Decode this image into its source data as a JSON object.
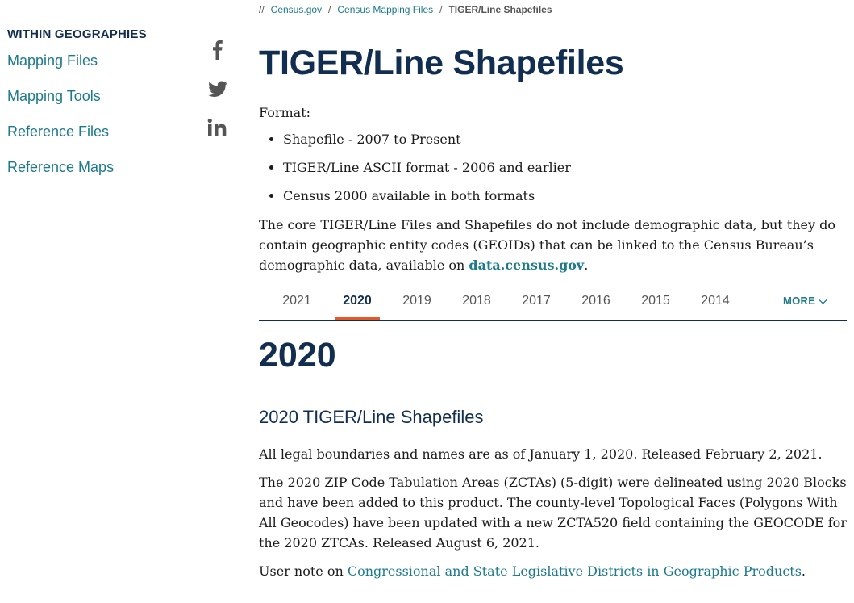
{
  "sidebar": {
    "heading": "WITHIN GEOGRAPHIES",
    "items": [
      {
        "label": "Mapping Files"
      },
      {
        "label": "Mapping Tools"
      },
      {
        "label": "Reference Files"
      },
      {
        "label": "Reference Maps"
      }
    ]
  },
  "social": {
    "icons": [
      "facebook-icon",
      "twitter-icon",
      "linkedin-icon"
    ]
  },
  "breadcrumb": {
    "lead": "//",
    "items": [
      "Census.gov",
      "Census Mapping Files"
    ],
    "separator": "/",
    "current": "TIGER/Line Shapefiles"
  },
  "page": {
    "title": "TIGER/Line Shapefiles",
    "format_label": "Format:",
    "format_items": [
      "Shapefile - 2007 to Present",
      "TIGER/Line ASCII format - 2006 and earlier",
      "Census 2000 available in both formats"
    ],
    "intro_text": "The core TIGER/Line Files and Shapefiles do not include demographic data, but they do contain geographic entity codes (GEOIDs) that can be linked to the Census Bureau’s demographic data, available on ",
    "intro_link": "data.census.gov",
    "intro_end": "."
  },
  "tabs": {
    "items": [
      "2021",
      "2020",
      "2019",
      "2018",
      "2017",
      "2016",
      "2015",
      "2014"
    ],
    "active": "2020",
    "more_label": "MORE"
  },
  "content": {
    "year_heading": "2020",
    "section_heading": "2020 TIGER/Line Shapefiles",
    "p1": "All legal boundaries and names are as of January 1, 2020. Released February 2, 2021.",
    "p2": "The 2020 ZIP Code Tabulation Areas (ZCTAs) (5-digit) were delineated using 2020 Blocks and have been added to this product. The county-level Topological Faces (Polygons With All Geocodes) have been updated with a new ZCTA520 field containing the GEOCODE for the 2020 ZTCAs. Released August 6, 2021.",
    "p3_prefix": "User note on ",
    "p3_link": "Congressional and State Legislative Districts in Geographic Products",
    "p3_end": "."
  },
  "colors": {
    "navy": "#112e51",
    "teal": "#1b7a8c",
    "accent": "#e8562a"
  }
}
